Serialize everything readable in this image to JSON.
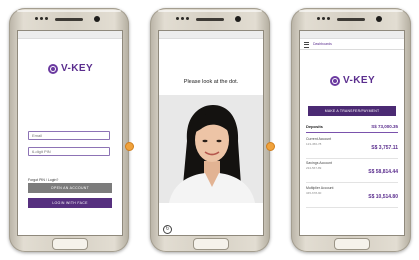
{
  "brand": {
    "name": "V-KEY",
    "color": "#5b2e8e"
  },
  "login": {
    "email_placeholder": "Email",
    "pin_placeholder": "6-digit PIN",
    "forgot_link": "Forgot PIN / Login?",
    "open_account_label": "OPEN AN ACCOUNT",
    "login_face_label": "LOGIN WITH FACE"
  },
  "face": {
    "instruction": "Please look at the dot."
  },
  "dashboard": {
    "topbar_title": "Dashboards",
    "transfer_label": "MAKE A TRANSFER/PAYMENT",
    "section_title": "Deposits",
    "total": "S$ 73,000.35",
    "accounts": [
      {
        "name": "Current Account",
        "number": "123-456-78",
        "balance": "S$ 3,757.11"
      },
      {
        "name": "Savings Account",
        "number": "234-567-89",
        "balance": "S$ 58,814.44"
      },
      {
        "name": "Multiplier Account",
        "number": "345-678-90",
        "balance": "S$ 10,514.80"
      }
    ]
  }
}
